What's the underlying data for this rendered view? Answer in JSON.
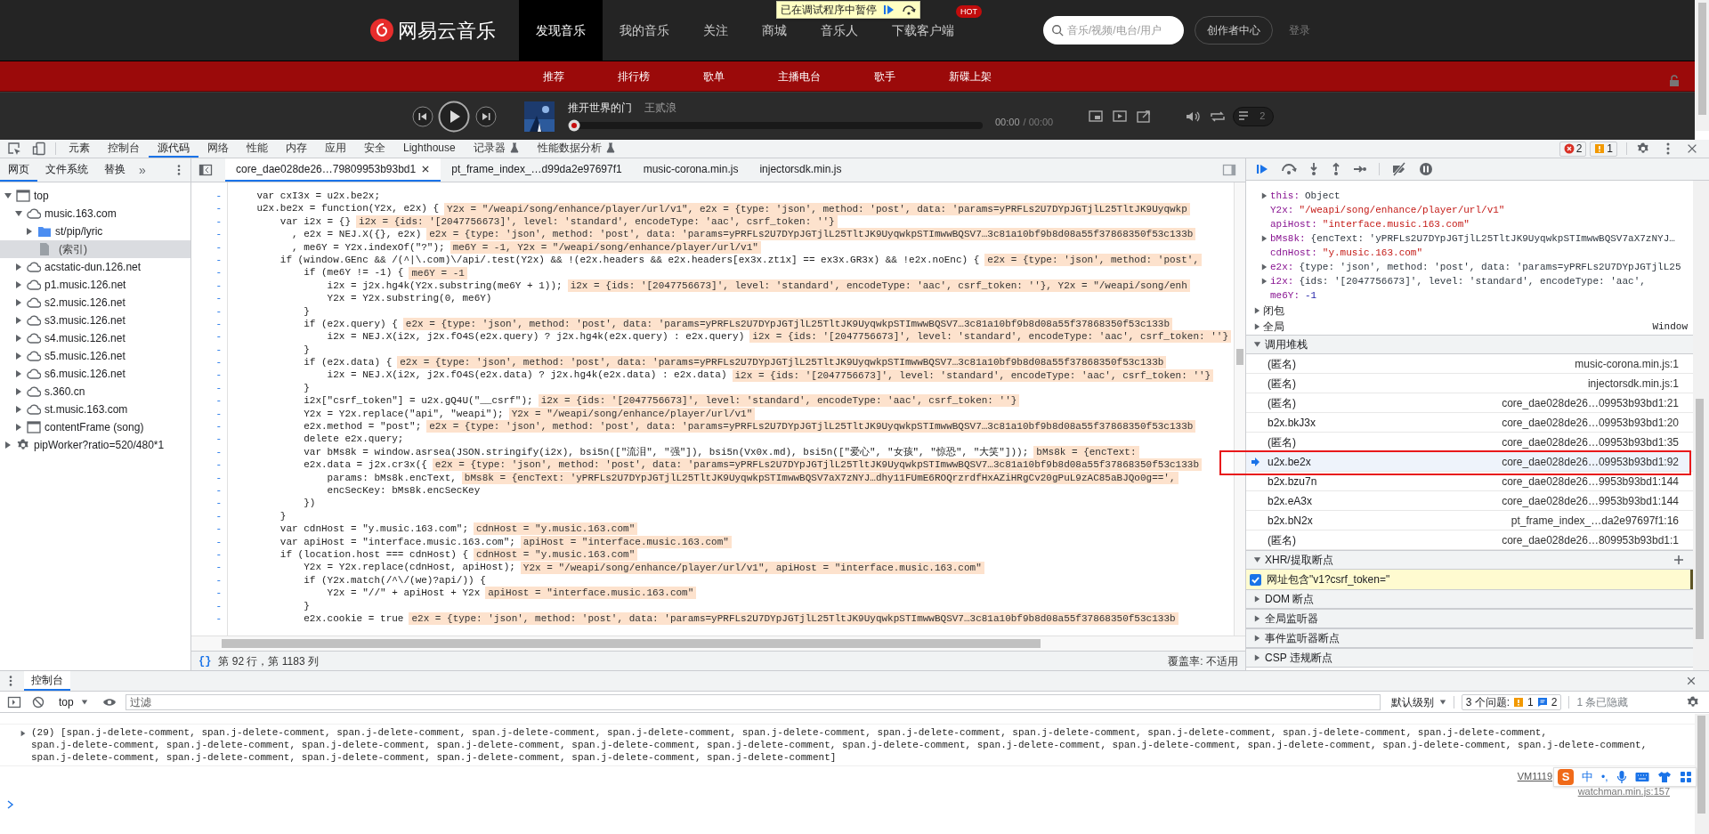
{
  "site_header": {
    "logo": "网易云音乐",
    "nav": [
      {
        "label": "发现音乐",
        "selected": true
      },
      {
        "label": "我的音乐",
        "selected": false
      },
      {
        "label": "关注",
        "selected": false
      },
      {
        "label": "商城",
        "selected": false
      },
      {
        "label": "音乐人",
        "selected": false
      },
      {
        "label": "下载客户端",
        "selected": false,
        "badge": "HOT"
      }
    ],
    "search": {
      "placeholder": "音乐/视频/电台/用户"
    },
    "creator_button": "创作者中心",
    "login": "登录"
  },
  "paused_banner": {
    "text": "已在调试程序中暂停"
  },
  "subnav": [
    "推荐",
    "排行榜",
    "歌单",
    "主播电台",
    "歌手",
    "新碟上架"
  ],
  "player": {
    "title": "推开世界的门",
    "artist": "王贰浪",
    "level": 0,
    "time": "00:00",
    "duration": "/ 00:00",
    "playlist_count": "2"
  },
  "devtools": {
    "panels": [
      {
        "label": "元素",
        "selected": false,
        "experimental": false
      },
      {
        "label": "控制台",
        "selected": false,
        "experimental": false
      },
      {
        "label": "源代码",
        "selected": true,
        "experimental": false
      },
      {
        "label": "网络",
        "selected": false,
        "experimental": false
      },
      {
        "label": "性能",
        "selected": false,
        "experimental": false
      },
      {
        "label": "内存",
        "selected": false,
        "experimental": false
      },
      {
        "label": "应用",
        "selected": false,
        "experimental": false
      },
      {
        "label": "安全",
        "selected": false,
        "experimental": false
      },
      {
        "label": "Lighthouse",
        "selected": false,
        "experimental": false
      },
      {
        "label": "记录器",
        "selected": false,
        "experimental": true
      },
      {
        "label": "性能数据分析",
        "selected": false,
        "experimental": true
      }
    ],
    "errors": "2",
    "warnings": "1"
  },
  "navigator": {
    "tabs": [
      {
        "label": "网页",
        "selected": true
      },
      {
        "label": "文件系统",
        "selected": false
      },
      {
        "label": "替换",
        "selected": false
      }
    ],
    "more": "»",
    "tree": [
      {
        "label": "top",
        "kind": "frame",
        "expanded": true,
        "selected": false,
        "children": [
          {
            "label": "music.163.com",
            "kind": "domain",
            "expanded": true,
            "selected": false,
            "children": [
              {
                "label": "st/pip/lyric",
                "kind": "folder",
                "expanded": false,
                "selected": false
              },
              {
                "label": "(索引)",
                "kind": "file",
                "selected": true
              }
            ]
          },
          {
            "label": "acstatic-dun.126.net",
            "kind": "domain",
            "expanded": false,
            "selected": false
          },
          {
            "label": "p1.music.126.net",
            "kind": "domain",
            "expanded": false,
            "selected": false
          },
          {
            "label": "s2.music.126.net",
            "kind": "domain",
            "expanded": false,
            "selected": false
          },
          {
            "label": "s3.music.126.net",
            "kind": "domain",
            "expanded": false,
            "selected": false
          },
          {
            "label": "s4.music.126.net",
            "kind": "domain",
            "expanded": false,
            "selected": false
          },
          {
            "label": "s5.music.126.net",
            "kind": "domain",
            "expanded": false,
            "selected": false
          },
          {
            "label": "s6.music.126.net",
            "kind": "domain",
            "expanded": false,
            "selected": false
          },
          {
            "label": "s.360.cn",
            "kind": "domain",
            "expanded": false,
            "selected": false
          },
          {
            "label": "st.music.163.com",
            "kind": "domain",
            "expanded": false,
            "selected": false
          },
          {
            "label": "contentFrame (song)",
            "kind": "frame",
            "expanded": false,
            "selected": false
          }
        ]
      },
      {
        "label": "pipWorker?ratio=520/480*1",
        "kind": "worker",
        "expanded": false,
        "selected": false
      }
    ]
  },
  "editor_tabs": [
    {
      "label": "core_dae028de26…79809953b93bd1",
      "selected": true,
      "closable": true
    },
    {
      "label": "pt_frame_index_…d99da2e97697f1",
      "selected": false,
      "closable": false
    },
    {
      "label": "music-corona.min.js",
      "selected": false,
      "closable": false
    },
    {
      "label": "injectorsdk.min.js",
      "selected": false,
      "closable": false
    }
  ],
  "code_lines": [
    {
      "mark": "-",
      "code": "    var cxI3x = u2x.be2x;"
    },
    {
      "mark": "-",
      "code": "    u2x.be2x = function(Y2x, e2x) {",
      "value": "Y2x = \"/weapi/song/enhance/player/url/v1\", e2x = {type: 'json', method: 'post', data: 'params=yPRFLs2U7DYpJGTjlL25TltJK9Uyqwkp"
    },
    {
      "mark": "-",
      "code": "        var i2x = {}",
      "value": "i2x = {ids: '[2047756673]', level: 'standard', encodeType: 'aac', csrf_token: ''}"
    },
    {
      "mark": "-",
      "code": "          , e2x = NEJ.X({}, e2x)",
      "value": "e2x = {type: 'json', method: 'post', data: 'params=yPRFLs2U7DYpJGTjlL25TltJK9UyqwkpSTImwwBQSV7…3c81a10bf9b8d08a55f37868350f53c133b"
    },
    {
      "mark": "-",
      "code": "          , me6Y = Y2x.indexOf(\"?\");",
      "value": "me6Y = -1, Y2x = \"/weapi/song/enhance/player/url/v1\""
    },
    {
      "mark": "-",
      "code": "        if (window.GEnc && /(^|\\.com)\\/api/.test(Y2x) && !(e2x.headers && e2x.headers[ex3x.zt1x] == ex3x.GR3x) && !e2x.noEnc) {",
      "value": "e2x = {type: 'json', method: 'post',"
    },
    {
      "mark": "-",
      "code": "            if (me6Y != -1) {",
      "value": "me6Y = -1"
    },
    {
      "mark": "-",
      "code": "                i2x = j2x.hg4k(Y2x.substring(me6Y + 1));",
      "value": "i2x = {ids: '[2047756673]', level: 'standard', encodeType: 'aac', csrf_token: ''}, Y2x = \"/weapi/song/enh"
    },
    {
      "mark": "-",
      "code": "                Y2x = Y2x.substring(0, me6Y)"
    },
    {
      "mark": "-",
      "code": "            }"
    },
    {
      "mark": "-",
      "code": "            if (e2x.query) {",
      "value": "e2x = {type: 'json', method: 'post', data: 'params=yPRFLs2U7DYpJGTjlL25TltJK9UyqwkpSTImwwBQSV7…3c81a10bf9b8d08a55f37868350f53c133b"
    },
    {
      "mark": "-",
      "code": "                i2x = NEJ.X(i2x, j2x.fO4S(e2x.query) ? j2x.hg4k(e2x.query) : e2x.query)",
      "value": "i2x = {ids: '[2047756673]', level: 'standard', encodeType: 'aac', csrf_token: ''}"
    },
    {
      "mark": "-",
      "code": "            }"
    },
    {
      "mark": "-",
      "code": "            if (e2x.data) {",
      "value": "e2x = {type: 'json', method: 'post', data: 'params=yPRFLs2U7DYpJGTjlL25TltJK9UyqwkpSTImwwBQSV7…3c81a10bf9b8d08a55f37868350f53c133b"
    },
    {
      "mark": "-",
      "code": "                i2x = NEJ.X(i2x, j2x.fO4S(e2x.data) ? j2x.hg4k(e2x.data) : e2x.data)",
      "value": "i2x = {ids: '[2047756673]', level: 'standard', encodeType: 'aac', csrf_token: ''}"
    },
    {
      "mark": "-",
      "code": "            }"
    },
    {
      "mark": "-",
      "code": "            i2x[\"csrf_token\"] = u2x.gQ4U(\"__csrf\");",
      "value": "i2x = {ids: '[2047756673]', level: 'standard', encodeType: 'aac', csrf_token: ''}"
    },
    {
      "mark": "-",
      "code": "            Y2x = Y2x.replace(\"api\", \"weapi\");",
      "value": "Y2x = \"/weapi/song/enhance/player/url/v1\""
    },
    {
      "mark": "-",
      "code": "            e2x.method = \"post\";",
      "value": "e2x = {type: 'json', method: 'post', data: 'params=yPRFLs2U7DYpJGTjlL25TltJK9UyqwkpSTImwwBQSV7…3c81a10bf9b8d08a55f37868350f53c133b"
    },
    {
      "mark": "-",
      "code": "            delete e2x.query;"
    },
    {
      "mark": "-",
      "code": "            var bMs8k = window.asrsea(JSON.stringify(i2x), bsi5n([\"流泪\", \"强\"]), bsi5n(Vx0x.md), bsi5n([\"爱心\", \"女孩\", \"惊恐\", \"大笑\"]));",
      "value": "bMs8k = {encText:"
    },
    {
      "mark": "-",
      "code": "            e2x.data = j2x.cr3x({",
      "value": "e2x = {type: 'json', method: 'post', data: 'params=yPRFLs2U7DYpJGTjlL25TltJK9UyqwkpSTImwwBQSV7…3c81a10bf9b8d08a55f37868350f53c133b"
    },
    {
      "mark": "-",
      "code": "                params: bMs8k.encText,",
      "value": "bMs8k = {encText: 'yPRFLs2U7DYpJGTjlL25TltJK9UyqwkpSTImwwBQSV7aX7zNYJ…dhy11FUmE6ROQrzrdfHxAZiHRgCv20gPuL9zAC85aBJQo0g==',"
    },
    {
      "mark": "-",
      "code": "                encSecKey: bMs8k.encSecKey"
    },
    {
      "mark": "-",
      "code": "            })"
    },
    {
      "mark": "-",
      "code": "        }"
    },
    {
      "mark": "-",
      "code": "        var cdnHost = \"y.music.163.com\";",
      "value": "cdnHost = \"y.music.163.com\""
    },
    {
      "mark": "-",
      "code": "        var apiHost = \"interface.music.163.com\";",
      "value": "apiHost = \"interface.music.163.com\""
    },
    {
      "mark": "-",
      "code": "        if (location.host === cdnHost) {",
      "value": "cdnHost = \"y.music.163.com\""
    },
    {
      "mark": "-",
      "code": "            Y2x = Y2x.replace(cdnHost, apiHost);",
      "value": "Y2x = \"/weapi/song/enhance/player/url/v1\", apiHost = \"interface.music.163.com\""
    },
    {
      "mark": "-",
      "code": "            if (Y2x.match(/^\\/(we)?api/)) {"
    },
    {
      "mark": "-",
      "code": "                Y2x = \"//\" + apiHost + Y2x",
      "value": "apiHost = \"interface.music.163.com\""
    },
    {
      "mark": "-",
      "code": "            }"
    },
    {
      "mark": "-",
      "code": "            e2x.cookie = true",
      "value": "e2x = {type: 'json', method: 'post', data: 'params=yPRFLs2U7DYpJGTjlL25TltJK9UyqwkpSTImwwBQSV7…3c81a10bf9b8d08a55f37868350f53c133b"
    }
  ],
  "editor_status": {
    "format_button": "{}",
    "position": "第 92 行，第 1183 列",
    "coverage": "覆盖率: 不适用"
  },
  "scope": [
    {
      "name": "this:",
      "value": "Object",
      "kind": "object",
      "expandable": true
    },
    {
      "name": "Y2x:",
      "value": "\"/weapi/song/enhance/player/url/v1\"",
      "kind": "string",
      "expandable": false
    },
    {
      "name": "apiHost:",
      "value": "\"interface.music.163.com\"",
      "kind": "string",
      "expandable": false
    },
    {
      "name": "bMs8k:",
      "value": "{encText: 'yPRFLs2U7DYpJGTjlL25TltJK9UyqwkpSTImwwBQSV7aX7zNYJ…",
      "kind": "object",
      "expandable": true
    },
    {
      "name": "cdnHost:",
      "value": "\"y.music.163.com\"",
      "kind": "string",
      "expandable": false
    },
    {
      "name": "e2x:",
      "value": "{type: 'json', method: 'post', data: 'params=yPRFLs2U7DYpJGTjlL25",
      "kind": "object",
      "expandable": true
    },
    {
      "name": "i2x:",
      "value": "{ids: '[2047756673]', level: 'standard', encodeType: 'aac',",
      "kind": "object",
      "expandable": true
    },
    {
      "name": "me6Y:",
      "value": "-1",
      "kind": "number",
      "expandable": false
    }
  ],
  "scope_groups": [
    {
      "label": "闭包",
      "expanded": false
    },
    {
      "label": "全局",
      "expanded": false,
      "value": "Window"
    }
  ],
  "call_stack": {
    "title": "调用堆栈",
    "expanded": true,
    "frames": [
      {
        "name": "(匿名)",
        "location": "music-corona.min.js:1",
        "selected": false
      },
      {
        "name": "(匿名)",
        "location": "injectorsdk.min.js:1",
        "selected": false
      },
      {
        "name": "(匿名)",
        "location": "core_dae028de26…09953b93bd1:21",
        "selected": false
      },
      {
        "name": "b2x.bkJ3x",
        "location": "core_dae028de26…09953b93bd1:20",
        "selected": false
      },
      {
        "name": "(匿名)",
        "location": "core_dae028de26…09953b93bd1:35",
        "selected": false
      },
      {
        "name": "u2x.be2x",
        "location": "core_dae028de26…09953b93bd1:92",
        "selected": true
      },
      {
        "name": "b2x.bzu7n",
        "location": "core_dae028de26…9953b93bd1:144",
        "selected": false
      },
      {
        "name": "b2x.eA3x",
        "location": "core_dae028de26…9953b93bd1:144",
        "selected": false
      },
      {
        "name": "b2x.bN2x",
        "location": "pt_frame_index_…da2e97697f1:16",
        "selected": false
      },
      {
        "name": "(匿名)",
        "location": "core_dae028de26…809953b93bd1:1",
        "selected": false
      }
    ]
  },
  "xhr_breakpoints": {
    "title": "XHR/提取断点",
    "expanded": true,
    "items": [
      {
        "label": "网址包含\"v1?csrf_token=\"",
        "checked": true
      }
    ]
  },
  "sections": [
    {
      "title": "DOM 断点",
      "expanded": false
    },
    {
      "title": "全局监听器",
      "expanded": false
    },
    {
      "title": "事件监听器断点",
      "expanded": false
    },
    {
      "title": "CSP 违规断点",
      "expanded": false
    }
  ],
  "console": {
    "tab": "控制台",
    "context": "top",
    "filter_placeholder": "过滤",
    "levels": "默认级别",
    "issues_label": "3 个问题:",
    "issue_warnings": "1",
    "issue_info": "2",
    "hidden": "1 条已隐藏",
    "messages": [
      {
        "text": "(29) [span.j-delete-comment, span.j-delete-comment, span.j-delete-comment, span.j-delete-comment, span.j-delete-comment, span.j-delete-comment, span.j-delete-comment, span.j-delete-comment, span.j-delete-comment, span.j-delete-comment, span.j-delete-comment, span.j-delete-comment, span.j-delete-comment, span.j-delete-comment, span.j-delete-comment, span.j-delete-comment, span.j-delete-comment, span.j-delete-comment, span.j-delete-comment, span.j-delete-comment, span.j-delete-comment, span.j-delete-comment, span.j-delete-comment, span.j-delete-comment, span.j-delete-comment, span.j-delete-comment, span.j-delete-comment, span.j-delete-comment, span.j-delete-comment]",
        "expandable": true
      }
    ],
    "source_link": "VM1119",
    "source_link_2": "watchman.min.js:157"
  },
  "ime_bar": {
    "logo": "S",
    "mode": "中",
    "punctuation": "•,"
  }
}
